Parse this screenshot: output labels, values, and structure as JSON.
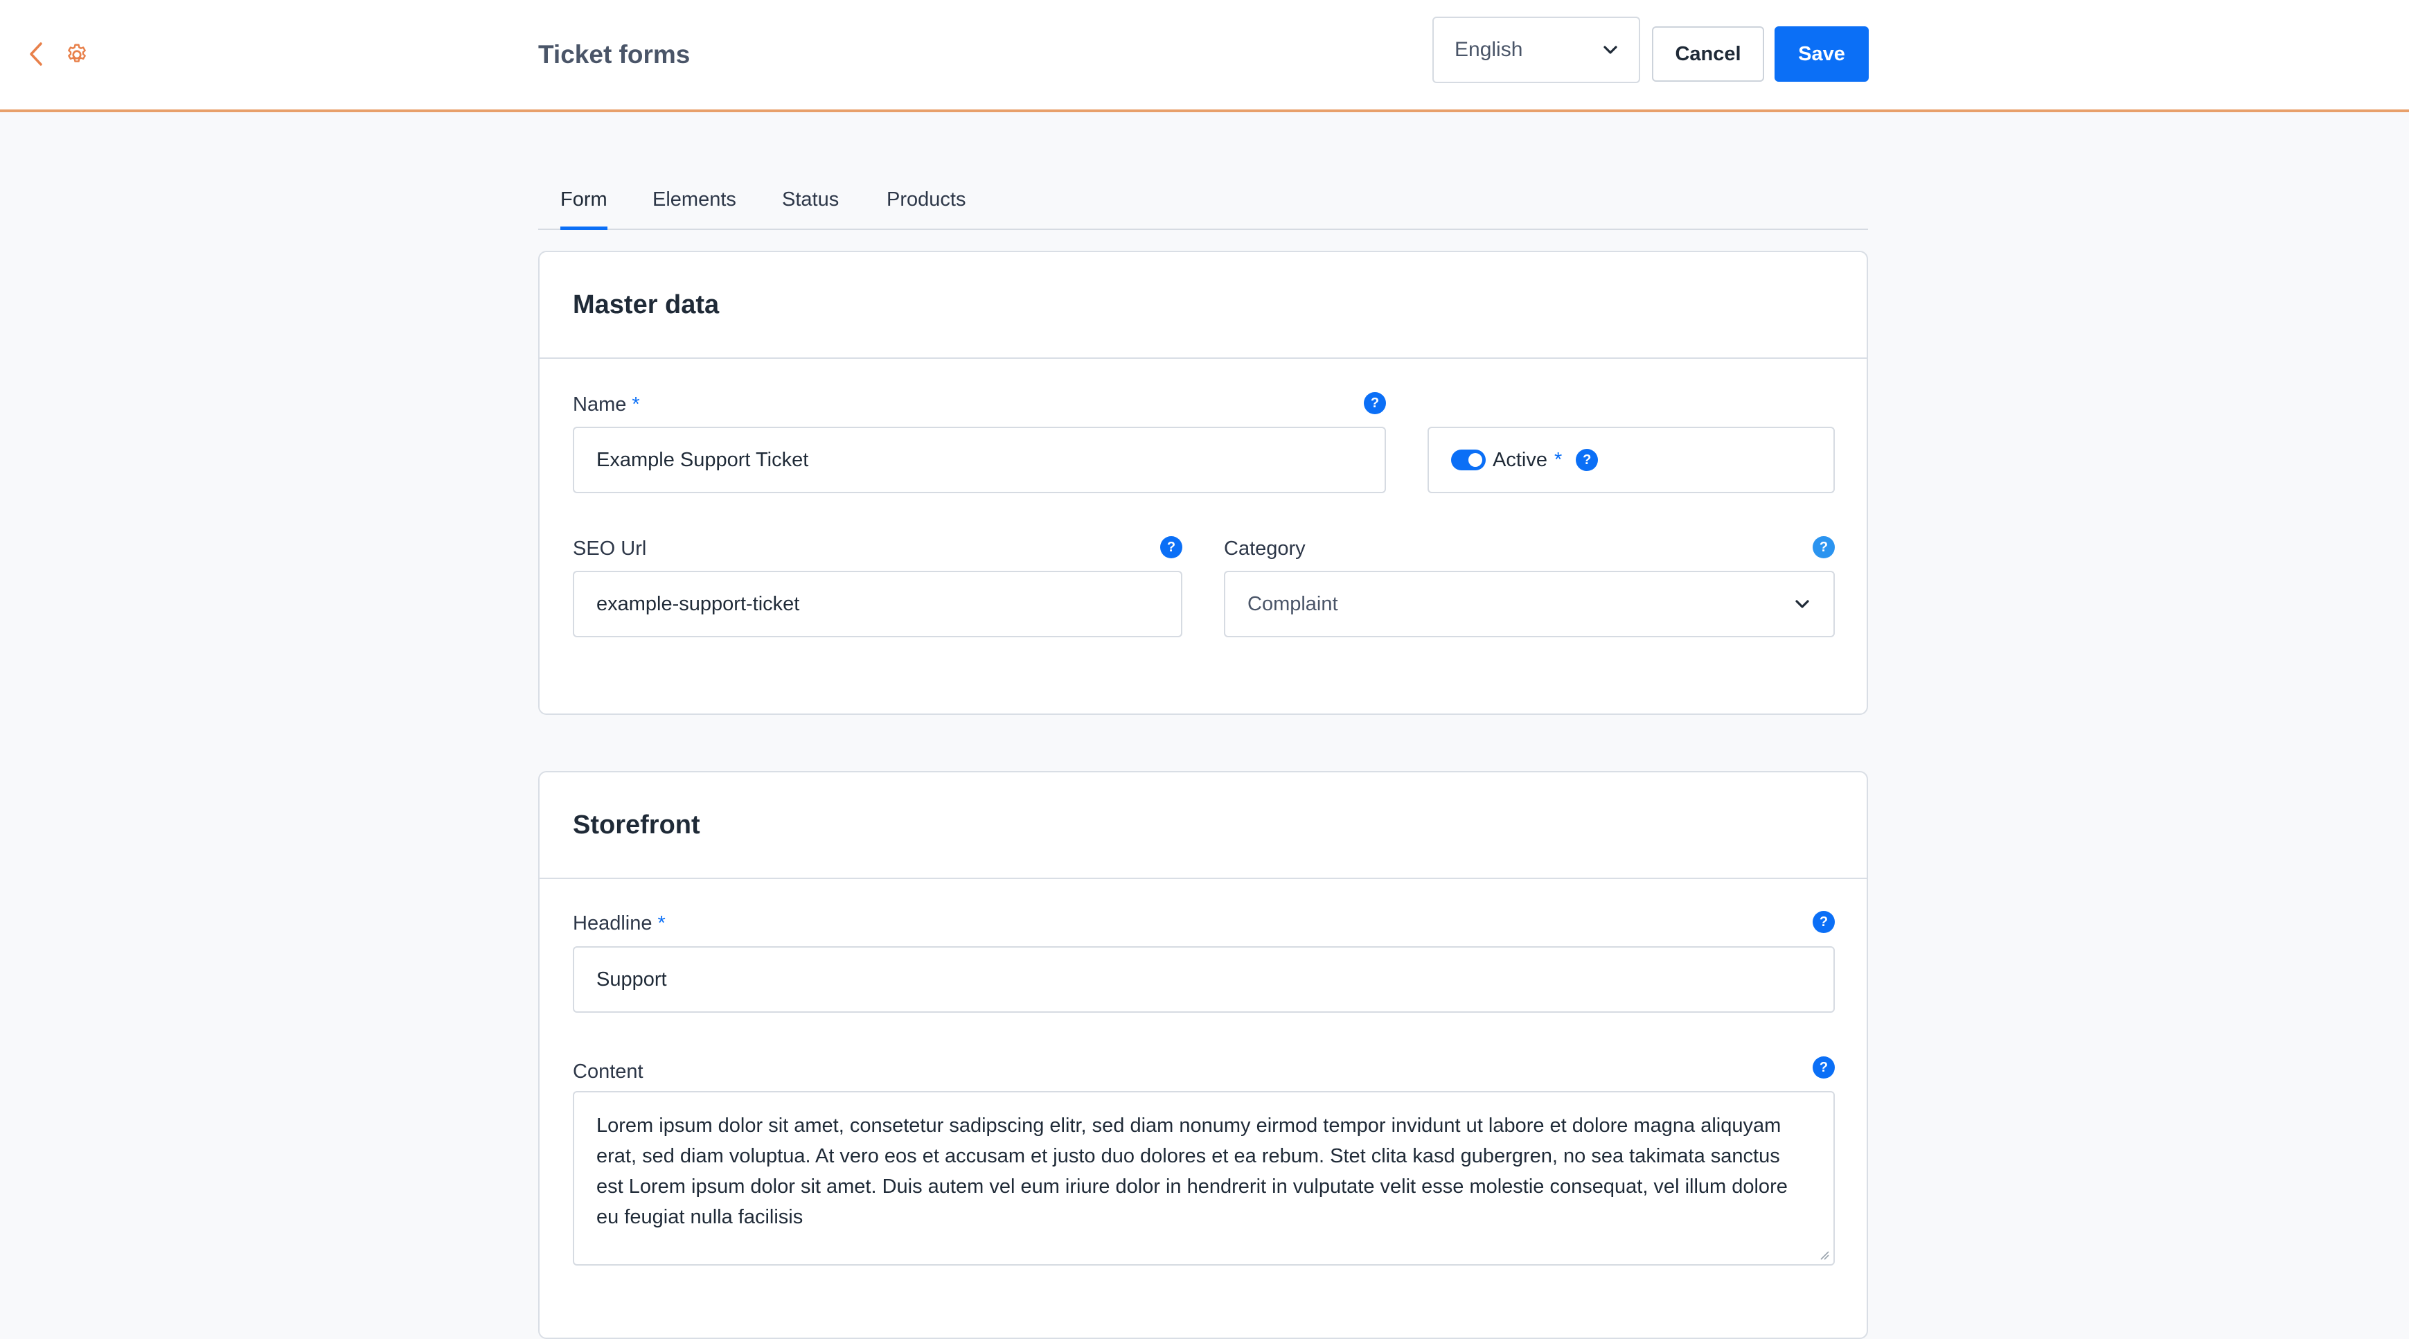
{
  "header": {
    "title": "Ticket forms",
    "language": "English",
    "cancel_label": "Cancel",
    "save_label": "Save",
    "accent_color": "#e8a06b",
    "primary_color": "#0b6ff6"
  },
  "tabs": [
    {
      "label": "Form",
      "active": true
    },
    {
      "label": "Elements",
      "active": false
    },
    {
      "label": "Status",
      "active": false
    },
    {
      "label": "Products",
      "active": false
    }
  ],
  "master_data": {
    "title": "Master data",
    "name_label": "Name",
    "name_value": "Example Support Ticket",
    "active_label": "Active",
    "active_on": true,
    "seo_label": "SEO Url",
    "seo_value": "example-support-ticket",
    "category_label": "Category",
    "category_value": "Complaint",
    "required_mark": "*"
  },
  "storefront": {
    "title": "Storefront",
    "headline_label": "Headline",
    "headline_value": "Support",
    "content_label": "Content",
    "content_value": "Lorem ipsum dolor sit amet, consetetur sadipscing elitr, sed diam nonumy eirmod tempor invidunt ut labore et dolore magna aliquyam erat, sed diam voluptua. At vero eos et accusam et justo duo dolores et ea rebum. Stet clita kasd gubergren, no sea takimata sanctus est Lorem ipsum dolor sit amet. Duis autem vel eum iriure dolor in hendrerit in vulputate velit esse molestie consequat, vel illum dolore eu feugiat nulla facilisis",
    "required_mark": "*"
  },
  "icons": {
    "back": "chevron-left-icon",
    "settings": "gear-icon",
    "dropdown": "chevron-down-icon",
    "help": "question-mark-icon",
    "help_glyph": "?"
  }
}
